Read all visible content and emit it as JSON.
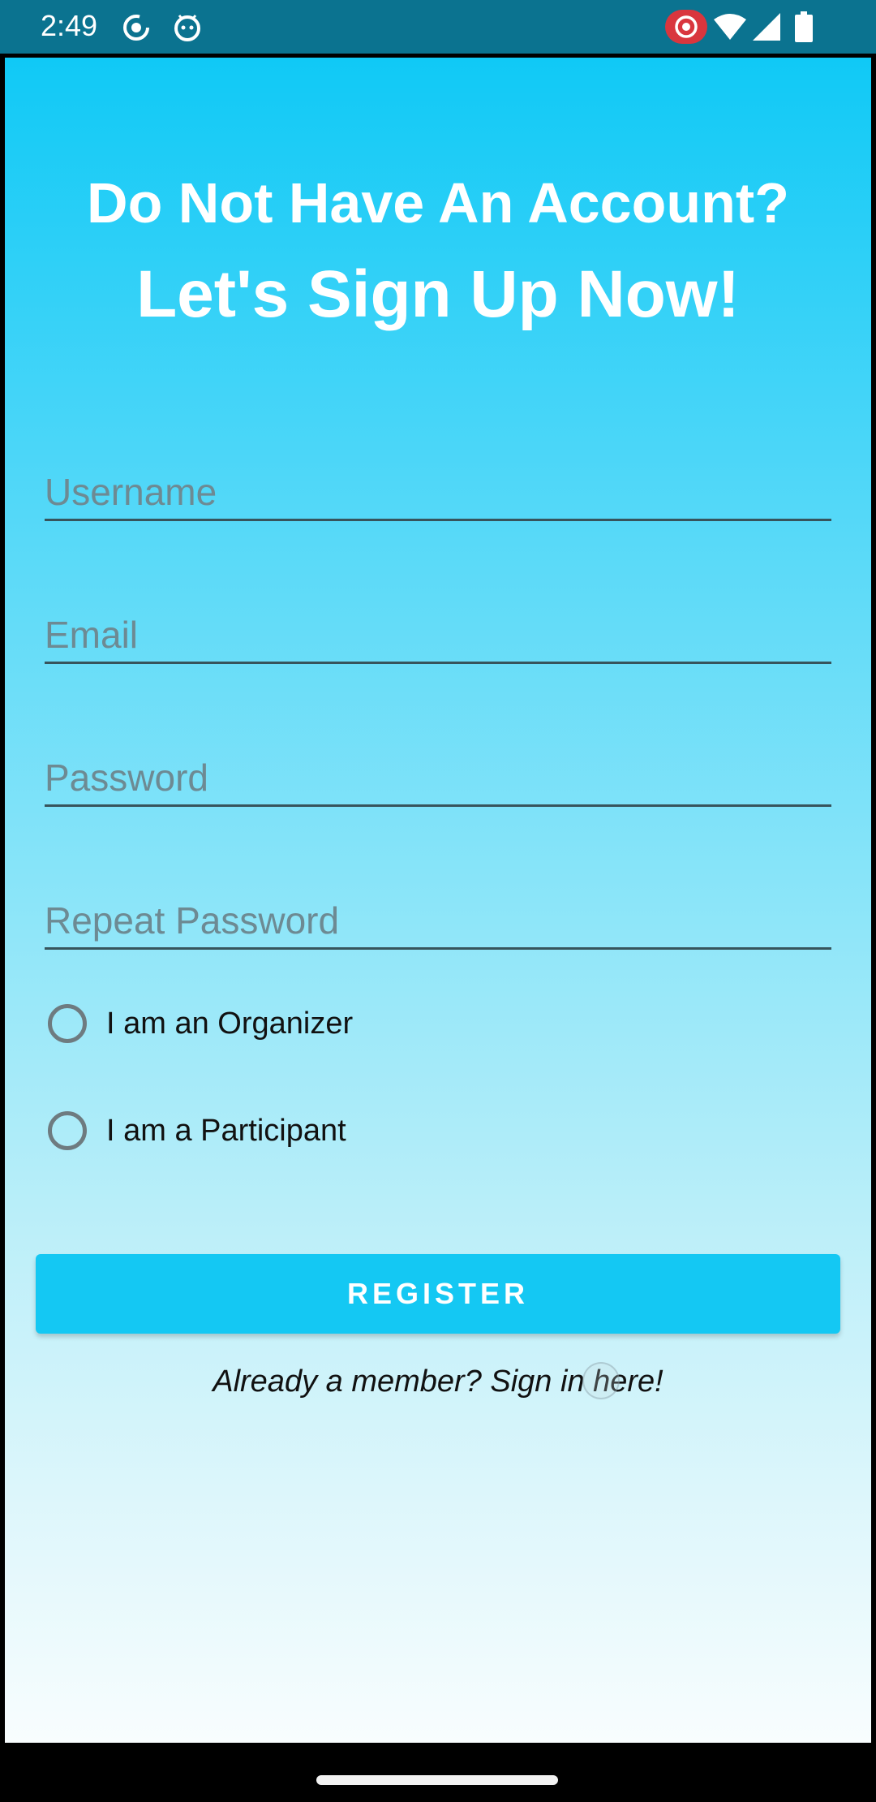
{
  "status_bar": {
    "time": "2:49",
    "icons": [
      "screen-record-icon",
      "android-debug-icon",
      "record-indicator-icon",
      "wifi-icon",
      "cell-signal-icon",
      "battery-icon"
    ],
    "background_color": "#0b7390"
  },
  "header": {
    "line1": "Do Not Have An Account?",
    "line2": "Let's Sign Up Now!"
  },
  "form": {
    "username_placeholder": "Username",
    "email_placeholder": "Email",
    "password_placeholder": "Password",
    "repeat_password_placeholder": "Repeat Password",
    "username_value": "",
    "email_value": "",
    "password_value": "",
    "repeat_password_value": ""
  },
  "role_options": {
    "organizer_label": "I am an Organizer",
    "participant_label": "I am a Participant",
    "selected": null
  },
  "actions": {
    "register_label": "REGISTER",
    "signin_link": "Already a member? Sign in here!"
  },
  "colors": {
    "accent": "#14c8f3",
    "gradient_top": "#10c9f6",
    "gradient_bottom": "#f8fdfe"
  }
}
